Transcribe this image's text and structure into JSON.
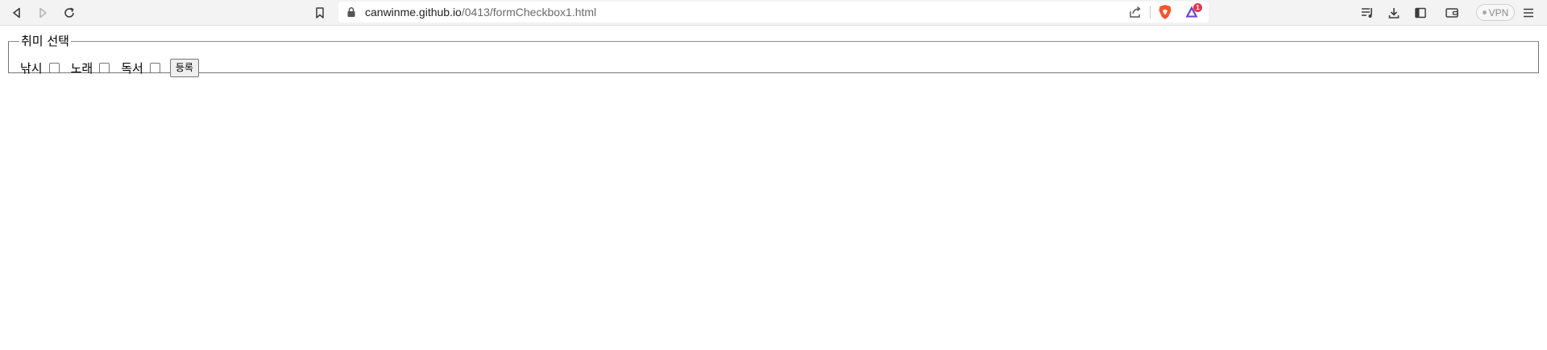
{
  "browser": {
    "url_host": "canwinme.github.io",
    "url_path": "/0413/formCheckbox1.html",
    "rewards_badge": "1",
    "vpn_label": "VPN"
  },
  "form": {
    "legend": "취미 선택",
    "options": [
      {
        "label": "낚시",
        "checked": false
      },
      {
        "label": "노래",
        "checked": false
      },
      {
        "label": "독서",
        "checked": false
      }
    ],
    "submit_label": "등록"
  }
}
